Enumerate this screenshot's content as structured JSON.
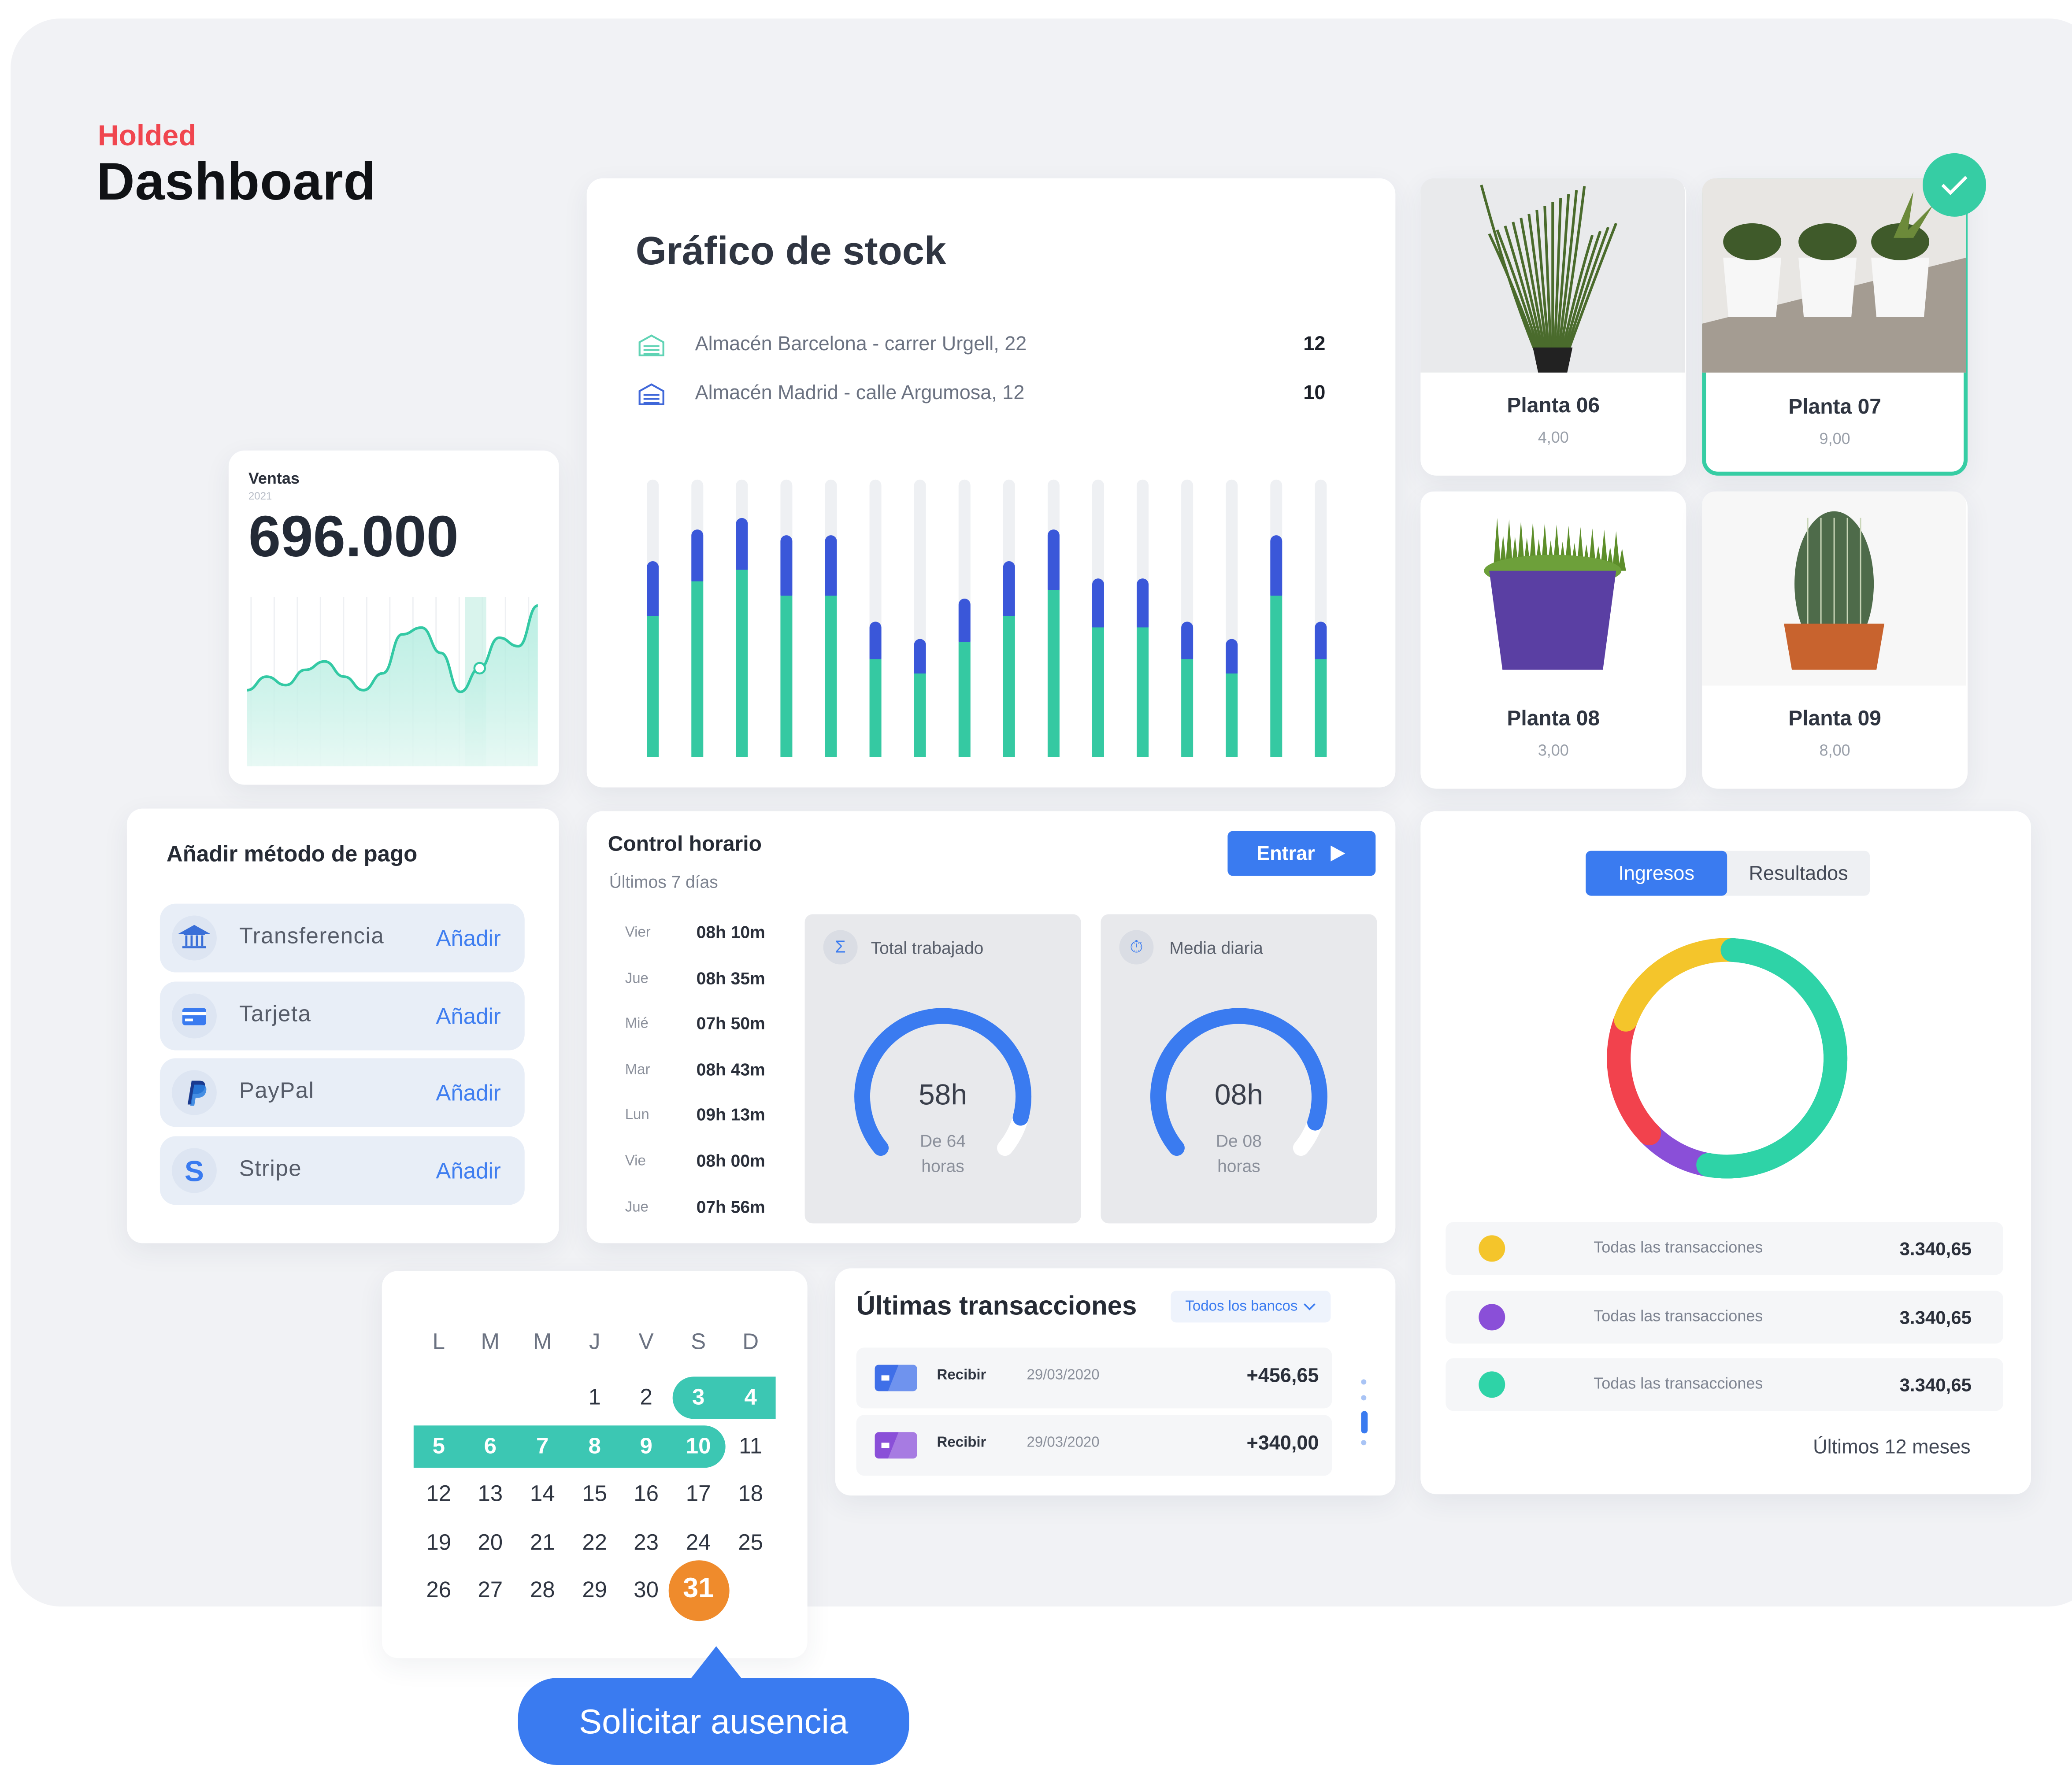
{
  "header": {
    "brand": "Holded",
    "title": "Dashboard"
  },
  "sales": {
    "label": "Ventas",
    "year": "2021",
    "value": "696.000",
    "trend": [
      0.55,
      0.47,
      0.52,
      0.43,
      0.38,
      0.47,
      0.55,
      0.45,
      0.22,
      0.18,
      0.33,
      0.56,
      0.42,
      0.24,
      0.29,
      0.05
    ]
  },
  "stock": {
    "title": "Gráfico de stock",
    "warehouses": [
      {
        "name": "Almacén Barcelona - carrer Urgell, 22",
        "count": "12",
        "icon": "warehouse-icon",
        "color": "#5fd3b4"
      },
      {
        "name": "Almacén Madrid - calle Argumosa, 12",
        "count": "10",
        "icon": "warehouse-icon",
        "color": "#3f67d9"
      }
    ],
    "chart_data": {
      "type": "bar",
      "series": [
        {
          "color": "#35c9a2",
          "values": [
            0.49,
            0.61,
            0.65,
            0.56,
            0.56,
            0.34,
            0.29,
            0.4,
            0.49,
            0.58,
            0.45,
            0.45,
            0.34,
            0.29,
            0.56,
            0.34
          ]
        },
        {
          "color": "#3a57d9",
          "values": [
            0.19,
            0.18,
            0.18,
            0.21,
            0.21,
            0.13,
            0.12,
            0.15,
            0.19,
            0.21,
            0.17,
            0.17,
            0.13,
            0.12,
            0.21,
            0.13
          ]
        }
      ]
    }
  },
  "plants": [
    {
      "name": "Planta 06",
      "price": "4,00",
      "selected": false
    },
    {
      "name": "Planta 07",
      "price": "9,00",
      "selected": true
    },
    {
      "name": "Planta 08",
      "price": "3,00",
      "selected": false
    },
    {
      "name": "Planta 09",
      "price": "8,00",
      "selected": false
    }
  ],
  "payment": {
    "title": "Añadir método de pago",
    "methods": [
      {
        "label": "Transferencia",
        "action": "Añadir",
        "icon": "bank-icon"
      },
      {
        "label": "Tarjeta",
        "action": "Añadir",
        "icon": "card-icon"
      },
      {
        "label": "PayPal",
        "action": "Añadir",
        "icon": "paypal-icon"
      },
      {
        "label": "Stripe",
        "action": "Añadir",
        "icon": "stripe-icon"
      }
    ]
  },
  "schedule": {
    "title": "Control horario",
    "subtitle": "Últimos 7 días",
    "enter_label": "Entrar",
    "days": [
      {
        "day": "Vier",
        "hours": "08h 10m"
      },
      {
        "day": "Jue",
        "hours": "08h 35m"
      },
      {
        "day": "Mié",
        "hours": "07h 50m"
      },
      {
        "day": "Mar",
        "hours": "08h 43m"
      },
      {
        "day": "Lun",
        "hours": "09h 13m"
      },
      {
        "day": "Vie",
        "hours": "08h 00m"
      },
      {
        "day": "Jue",
        "hours": "07h 56m"
      }
    ],
    "total": {
      "label": "Total trabajado",
      "value": "58h",
      "of_line1": "De 64",
      "of_line2": "horas",
      "fraction": 0.906
    },
    "average": {
      "label": "Media diaria",
      "value": "08h",
      "of_line1": "De 08",
      "of_line2": "horas",
      "fraction": 0.92
    }
  },
  "income": {
    "tabs": [
      "Ingresos",
      "Resultados"
    ],
    "active_tab": "Ingresos",
    "donut": [
      {
        "color": "#2ed3a7",
        "share": 0.52
      },
      {
        "color": "#8a4fd8",
        "share": 0.1
      },
      {
        "color": "#f2424d",
        "share": 0.18
      },
      {
        "color": "#f4c52b",
        "share": 0.2
      }
    ],
    "legend": [
      {
        "color": "#f4c52b",
        "label": "Todas las transacciones",
        "value": "3.340,65"
      },
      {
        "color": "#8a4fd8",
        "label": "Todas las transacciones",
        "value": "3.340,65"
      },
      {
        "color": "#2ed3a7",
        "label": "Todas las transacciones",
        "value": "3.340,65"
      }
    ],
    "footer": "Últimos 12 meses"
  },
  "calendar": {
    "weekdays": [
      "L",
      "M",
      "M",
      "J",
      "V",
      "S",
      "D"
    ],
    "first_weekday_index": 3,
    "days_in_month": 31,
    "selected_range": [
      3,
      10
    ],
    "today": "31"
  },
  "transactions": {
    "title": "Últimas transacciones",
    "filter": "Todos los bancos",
    "rows": [
      {
        "label": "Recibir",
        "date": "29/03/2020",
        "amount": "+456,65",
        "card_color": "#3f6fe8"
      },
      {
        "label": "Recibir",
        "date": "29/03/2020",
        "amount": "+340,00",
        "card_color": "#8a4fd8"
      }
    ]
  },
  "cta": {
    "label": "Solicitar ausencia"
  }
}
